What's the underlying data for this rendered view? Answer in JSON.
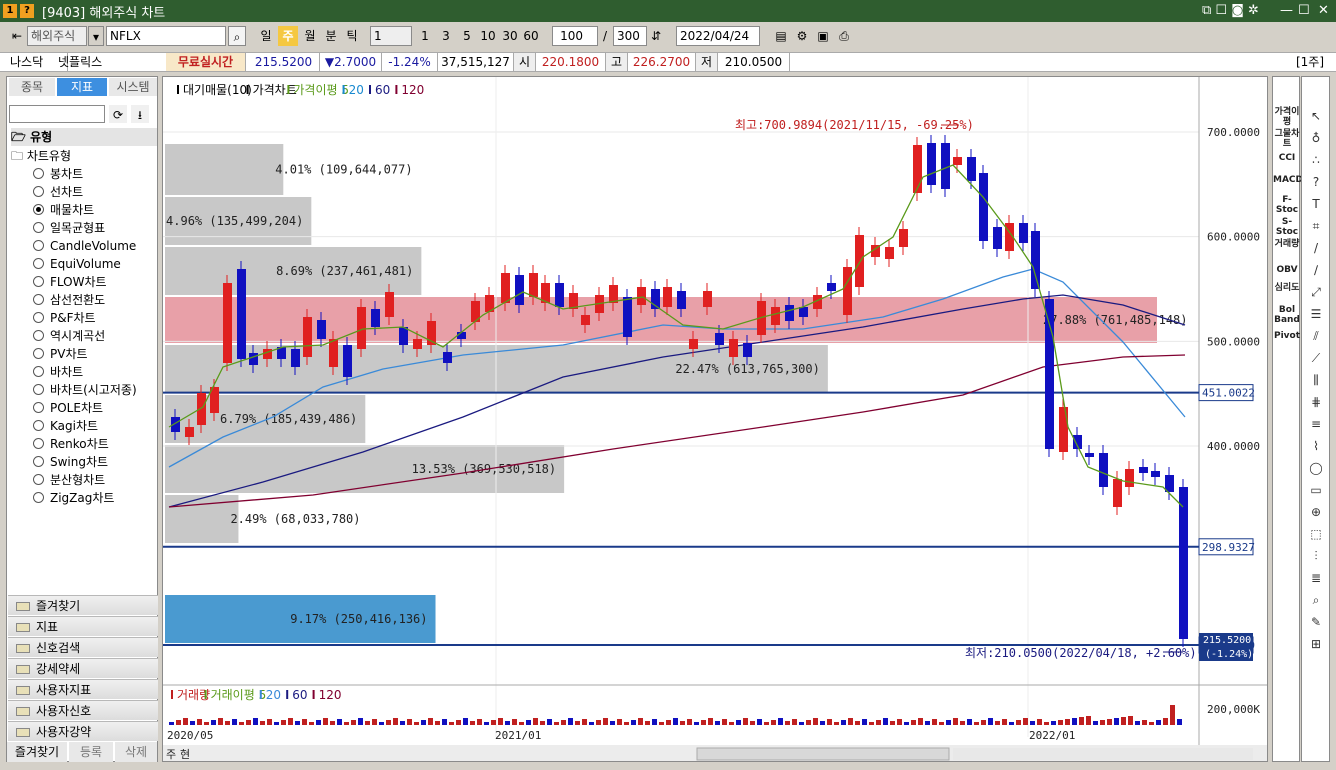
{
  "window": {
    "title": "[9403] 해외주식 차트",
    "icons": [
      "1",
      "?"
    ]
  },
  "toolbar": {
    "market": "해외주식",
    "symbol": "NFLX",
    "periods": [
      "일",
      "주",
      "월",
      "분",
      "틱"
    ],
    "active_period": "주",
    "unit": "1",
    "intervals": [
      "1",
      "3",
      "5",
      "10",
      "30",
      "60"
    ],
    "count": "100",
    "separator": "/",
    "max_count": "300",
    "date": "2022/04/24"
  },
  "pricebar": {
    "exchange": "나스닥",
    "name": "넷플릭스",
    "realtime": "무료실시간",
    "price": "215.5200",
    "change": "▼2.7000",
    "change_pct": "-1.24%",
    "volume": "37,515,127",
    "open_label": "시",
    "open": "220.1800",
    "high_label": "고",
    "high": "226.2700",
    "low_label": "저",
    "low": "210.0500",
    "unit_label": "[1주]"
  },
  "left": {
    "tabs": [
      "종목",
      "지표",
      "시스템"
    ],
    "active_tab": "지표",
    "section": "유형",
    "group": "차트유형",
    "types": [
      "봉차트",
      "선차트",
      "매물차트",
      "일목균형표",
      "CandleVolume",
      "EquiVolume",
      "FLOW차트",
      "삼선전환도",
      "P&F차트",
      "역시계곡선",
      "PV차트",
      "바차트",
      "바차트(시고저종)",
      "POLE차트",
      "Kagi차트",
      "Renko차트",
      "Swing차트",
      "분산형차트",
      "ZigZag차트"
    ],
    "selected_type": "매물차트",
    "folders": [
      "즐겨찾기",
      "지표",
      "신호검색",
      "강세약세",
      "사용자지표",
      "사용자신호",
      "사용자강약"
    ],
    "bottom_buttons": [
      "즐겨찾기",
      "등록",
      "삭제"
    ]
  },
  "chart": {
    "legend": [
      "대기매물(10)",
      "가격차트",
      "가격이평 5",
      "20",
      "60",
      "120"
    ],
    "legend_colors": [
      "#000000",
      "#000000",
      "#5a9a1a",
      "#1a8ad0",
      "#1a1a80",
      "#800030"
    ],
    "max_note": "최고:700.9894(2021/11/15, -69.25%)",
    "min_note": "최저:210.0500(2022/04/18, +2.60%)",
    "y_labels": [
      "700.0000",
      "600.0000",
      "500.0000",
      "400.0000"
    ],
    "hlines": [
      "451.0022",
      "298.9327",
      "210.0500"
    ],
    "current_price": "215.5200",
    "current_pct": "(-1.24%)",
    "volume_profile": [
      {
        "label": "4.01% (109,644,077)",
        "pct": 4.01,
        "highlight": ""
      },
      {
        "label": "4.96% (135,499,204)",
        "pct": 4.96,
        "highlight": ""
      },
      {
        "label": "8.69% (237,461,481)",
        "pct": 8.69,
        "highlight": ""
      },
      {
        "label": "27.88% (761,485,148)",
        "pct": 27.88,
        "highlight": "pink"
      },
      {
        "label": "22.47% (613,765,300)",
        "pct": 22.47,
        "highlight": ""
      },
      {
        "label": "6.79% (185,439,486)",
        "pct": 6.79,
        "highlight": ""
      },
      {
        "label": "13.53% (369,530,518)",
        "pct": 13.53,
        "highlight": ""
      },
      {
        "label": "2.49% (68,033,780)",
        "pct": 2.49,
        "highlight": ""
      },
      {
        "label": "9.17% (250,416,136)",
        "pct": 9.17,
        "highlight": "blue"
      }
    ],
    "volume_legend": [
      "거래량",
      "거래이평 5",
      "20",
      "60",
      "120"
    ],
    "volume_axis": "200,000K",
    "x_labels": [
      "2020/05",
      "2021/01",
      "2022/01"
    ],
    "bottom_buttons": [
      "주",
      "현"
    ]
  },
  "right_indicators": [
    "가격이평",
    "그물차트",
    "CCI",
    "MACD",
    "F-Stoc",
    "S-Stoc",
    "거래량",
    "OBV",
    "심리도",
    "Bol Band",
    "Pivot"
  ],
  "colors": {
    "up": "#e02020",
    "down": "#1010c0",
    "pink": "#e8a0a8",
    "gray": "#c8c8c8",
    "blue_zone": "#4a9ad0"
  }
}
